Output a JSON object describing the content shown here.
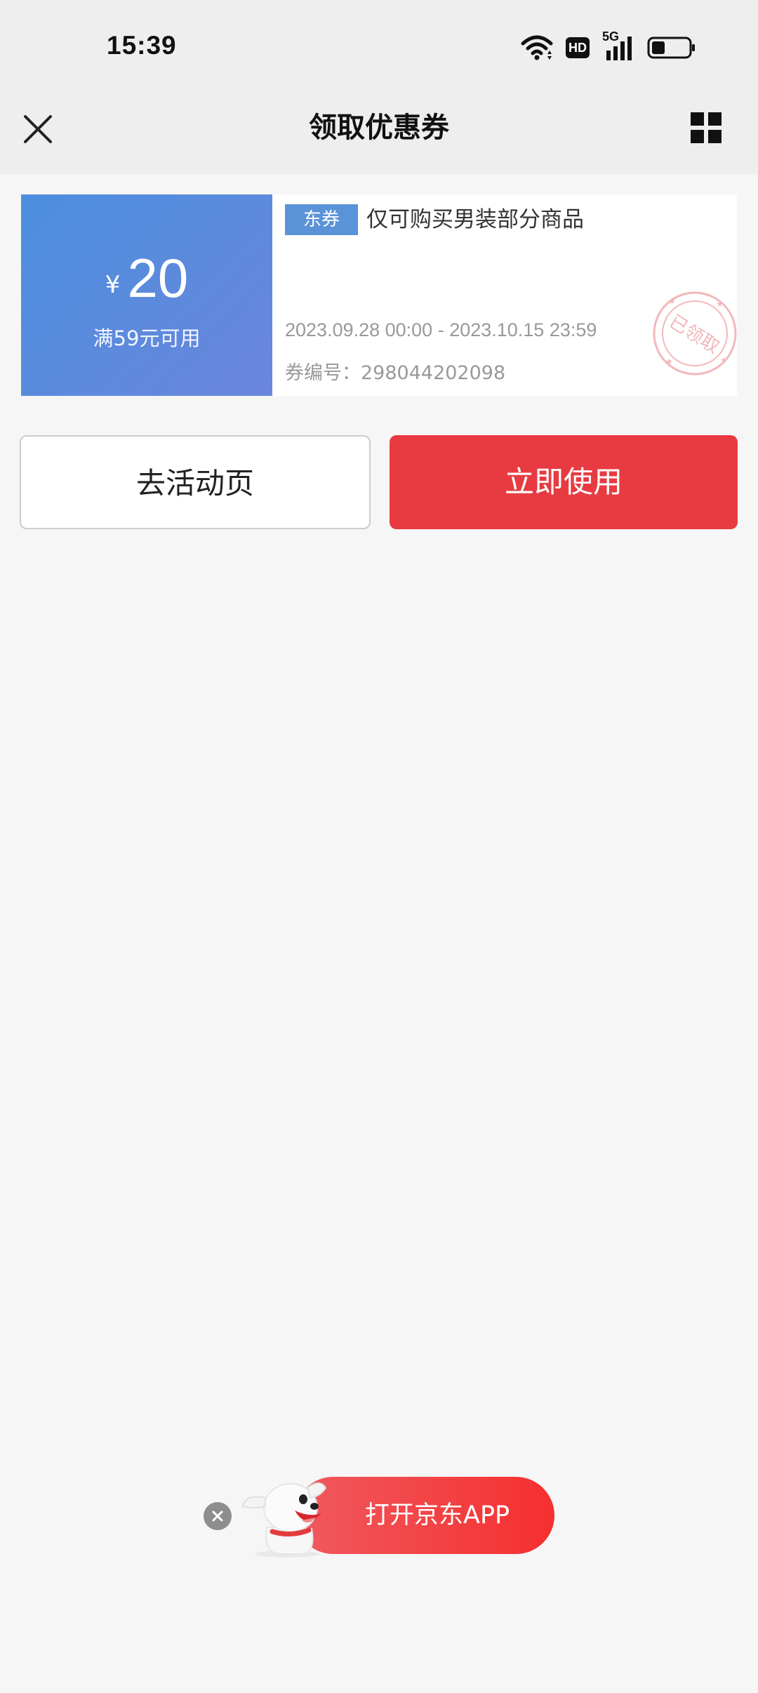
{
  "status_bar": {
    "time": "15:39",
    "icons": [
      "wifi-icon",
      "hd-icon",
      "5g-signal-icon",
      "battery-icon"
    ],
    "hd_label": "HD",
    "network_label": "5G"
  },
  "nav": {
    "title": "领取优惠券",
    "close_icon": "close-icon",
    "menu_icon": "grid-icon"
  },
  "coupon": {
    "currency": "¥",
    "value": "20",
    "condition": "满59元可用",
    "tag": "东券",
    "description": "仅可购买男装部分商品",
    "validity": "2023.09.28 00:00 - 2023.10.15 23:59",
    "code": "券编号：298044202098",
    "stamp_text": "已领取",
    "colors": {
      "left_gradient_start": "#4c8fde",
      "left_gradient_end": "#6a86dc",
      "tag_bg": "#5b93d8",
      "stamp": "#f2b8bb"
    }
  },
  "actions": {
    "activity_label": "去活动页",
    "use_label": "立即使用",
    "use_color": "#e83b41"
  },
  "open_app": {
    "label": "打开京东APP",
    "close_icon": "close-icon",
    "mascot_icon": "jd-dog-mascot-icon",
    "color": "#f52f2f"
  }
}
